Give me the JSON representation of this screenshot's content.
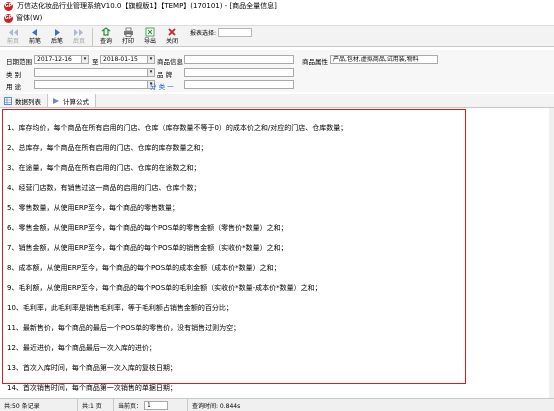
{
  "window": {
    "title": "万信达化妆品行业管理系统V10.0【旗舰版1】【TEMP】(170101) - [商品全量信息]"
  },
  "menu": {
    "items": [
      {
        "label": "窗体(W)"
      }
    ]
  },
  "toolbar": {
    "buttons": [
      {
        "label": "前页",
        "icon": "prev-page-icon",
        "enabled": false
      },
      {
        "label": "前笔",
        "icon": "prev-record-icon",
        "enabled": true
      },
      {
        "label": "后笔",
        "icon": "next-record-icon",
        "enabled": true
      },
      {
        "label": "后页",
        "icon": "next-page-icon",
        "enabled": false
      },
      {
        "label": "查询",
        "icon": "query-icon",
        "enabled": true
      },
      {
        "label": "打印",
        "icon": "print-icon",
        "enabled": true
      },
      {
        "label": "导出",
        "icon": "export-icon",
        "enabled": true
      },
      {
        "label": "关闭",
        "icon": "close-icon",
        "enabled": true
      }
    ],
    "report_select": {
      "label": "报表选择:",
      "value": ""
    }
  },
  "filters": {
    "date_range": {
      "label": "日期范围",
      "from": "2017-12-16",
      "to_label": "至",
      "to": "2018-01-15"
    },
    "product_info": {
      "label": "商品信息",
      "value": ""
    },
    "product_attr": {
      "label": "商品属性",
      "value": "产品,包材,虚拟商品,试用装,物料"
    },
    "category": {
      "label": "类    别",
      "value": ""
    },
    "brand": {
      "label": "品    牌",
      "value": ""
    },
    "usage": {
      "label": "用    途",
      "value": ""
    },
    "group": {
      "label": "分 类 一",
      "value": ""
    }
  },
  "tabs": [
    {
      "label": "数据列表",
      "icon": "grid-icon",
      "active": false
    },
    {
      "label": "计算公式",
      "icon": "formula-icon",
      "active": true
    }
  ],
  "formulas": [
    "1、库存均价，每个商品在所有启用的门店、仓库（库存数量不等于0）的成本价之和/对应的门店、仓库数量；",
    "2、总库存，每个商品在所有启用的门店、仓库的库存数量之和；",
    "3、在途量，每个商品在所有启用的门店、仓库的在途数之和；",
    "4、经营门店数，有销售过这一商品的启用的门店、仓库个数；",
    "5、零售数量，从使用ERP至今，每个商品的零售数量；",
    "6、零售金额，从使用ERP至今，每个商品的每个POS单的零售金额（零售价*数量）之和；",
    "7、销售金额，从使用ERP至今，每个商品的每个POS单的销售金额（实收价*数量）之和；",
    "8、成本额，从使用ERP至今，每个商品的每个POS单的成本金额（成本价*数量）之和；",
    "9、毛利额，从使用ERP至今，每个商品的每个POS单的毛利金额（实收价*数量-成本价*数量）之和；",
    "10、毛利率，此毛利率是销售毛利率，等于毛利额占销售金额的百分比；",
    "11、最新售价，每个商品的最后一个POS单的零售价，没有销售过则为空；",
    "12、最近进价，每个商品最后一次入库的进价；",
    "13、首次入库时间，每个商品第一次入库的复核日期；",
    "14、首次销售时间，每个商品第一次销售的单据日期；"
  ],
  "status": {
    "records": "共:50 条记录",
    "pages": "共:1 页",
    "current_page_label": "当前页：",
    "current_page": "1",
    "query_time": "查询时间: 0.844s"
  },
  "colors": {
    "highlight_border": "#d42020",
    "link_blue": "#1f5fd0",
    "logo_red": "#d02020"
  }
}
